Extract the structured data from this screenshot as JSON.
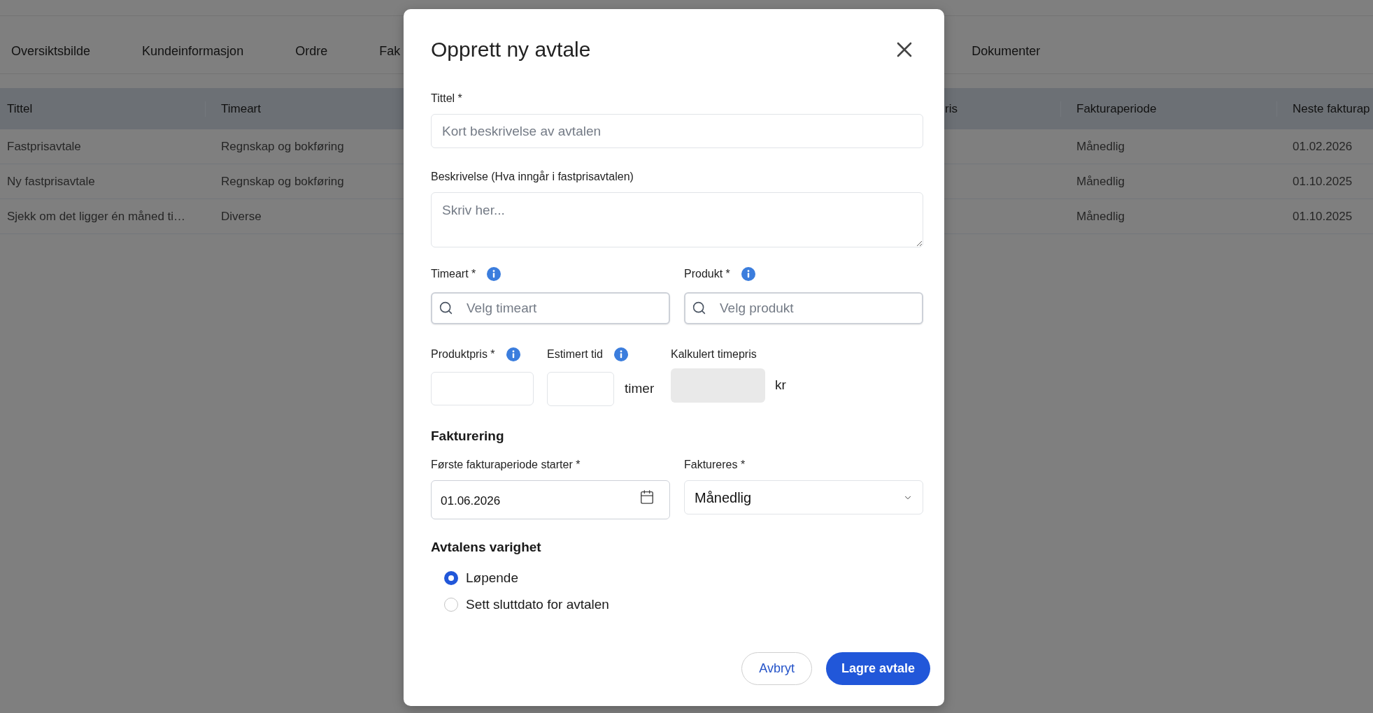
{
  "page": {
    "tabs": [
      "Oversiktsbilde",
      "Kundeinformasjon",
      "Ordre",
      "Fak",
      "Dokumenter"
    ],
    "table": {
      "columns": [
        "Tittel",
        "Timeart",
        "ris",
        "Fakturaperiode",
        "Neste fakturap"
      ],
      "rows": [
        {
          "tittel": "Fastprisavtale",
          "timeart": "Regnskap og bokføring",
          "fakturaperiode": "Månedlig",
          "neste_fakturap": "01.02.2026"
        },
        {
          "tittel": "Ny fastprisavtale",
          "timeart": "Regnskap og bokføring",
          "fakturaperiode": "Månedlig",
          "neste_fakturap": "01.10.2025"
        },
        {
          "tittel": "Sjekk om det ligger én måned ti…",
          "timeart": "Diverse",
          "fakturaperiode": "Månedlig",
          "neste_fakturap": "01.10.2025"
        }
      ]
    }
  },
  "dialog": {
    "title": "Opprett ny avtale",
    "title_field": {
      "label": "Tittel *",
      "placeholder": "Kort beskrivelse av avtalen"
    },
    "description_field": {
      "label": "Beskrivelse (Hva inngår i fastprisavtalen)",
      "placeholder": "Skriv her..."
    },
    "hour_type": {
      "label": "Timeart *",
      "info": true,
      "placeholder": "Velg timeart"
    },
    "product": {
      "label": "Produkt *",
      "info": true,
      "placeholder": "Velg produkt"
    },
    "product_price": {
      "label": "Produktpris *",
      "info": true
    },
    "estimated_time": {
      "label": "Estimert tid",
      "info": true,
      "unit": "timer"
    },
    "calculated_rate": {
      "label": "Kalkulert timepris",
      "unit": "kr",
      "disabled": true
    },
    "invoicing": {
      "heading": "Fakturering",
      "start": {
        "label": "Første fakturaperiode starter *",
        "value": "01.06.2026"
      },
      "frequency": {
        "label": "Faktureres *",
        "value": "Månedlig"
      }
    },
    "duration": {
      "heading": "Avtalens varighet",
      "options": [
        {
          "label": "Løpende",
          "selected": true
        },
        {
          "label": "Sett sluttdato for avtalen",
          "selected": false
        }
      ]
    },
    "buttons": [
      {
        "label": "Avbryt",
        "kind": "secondary"
      },
      {
        "label": "Lagre avtale",
        "kind": "primary"
      }
    ]
  }
}
